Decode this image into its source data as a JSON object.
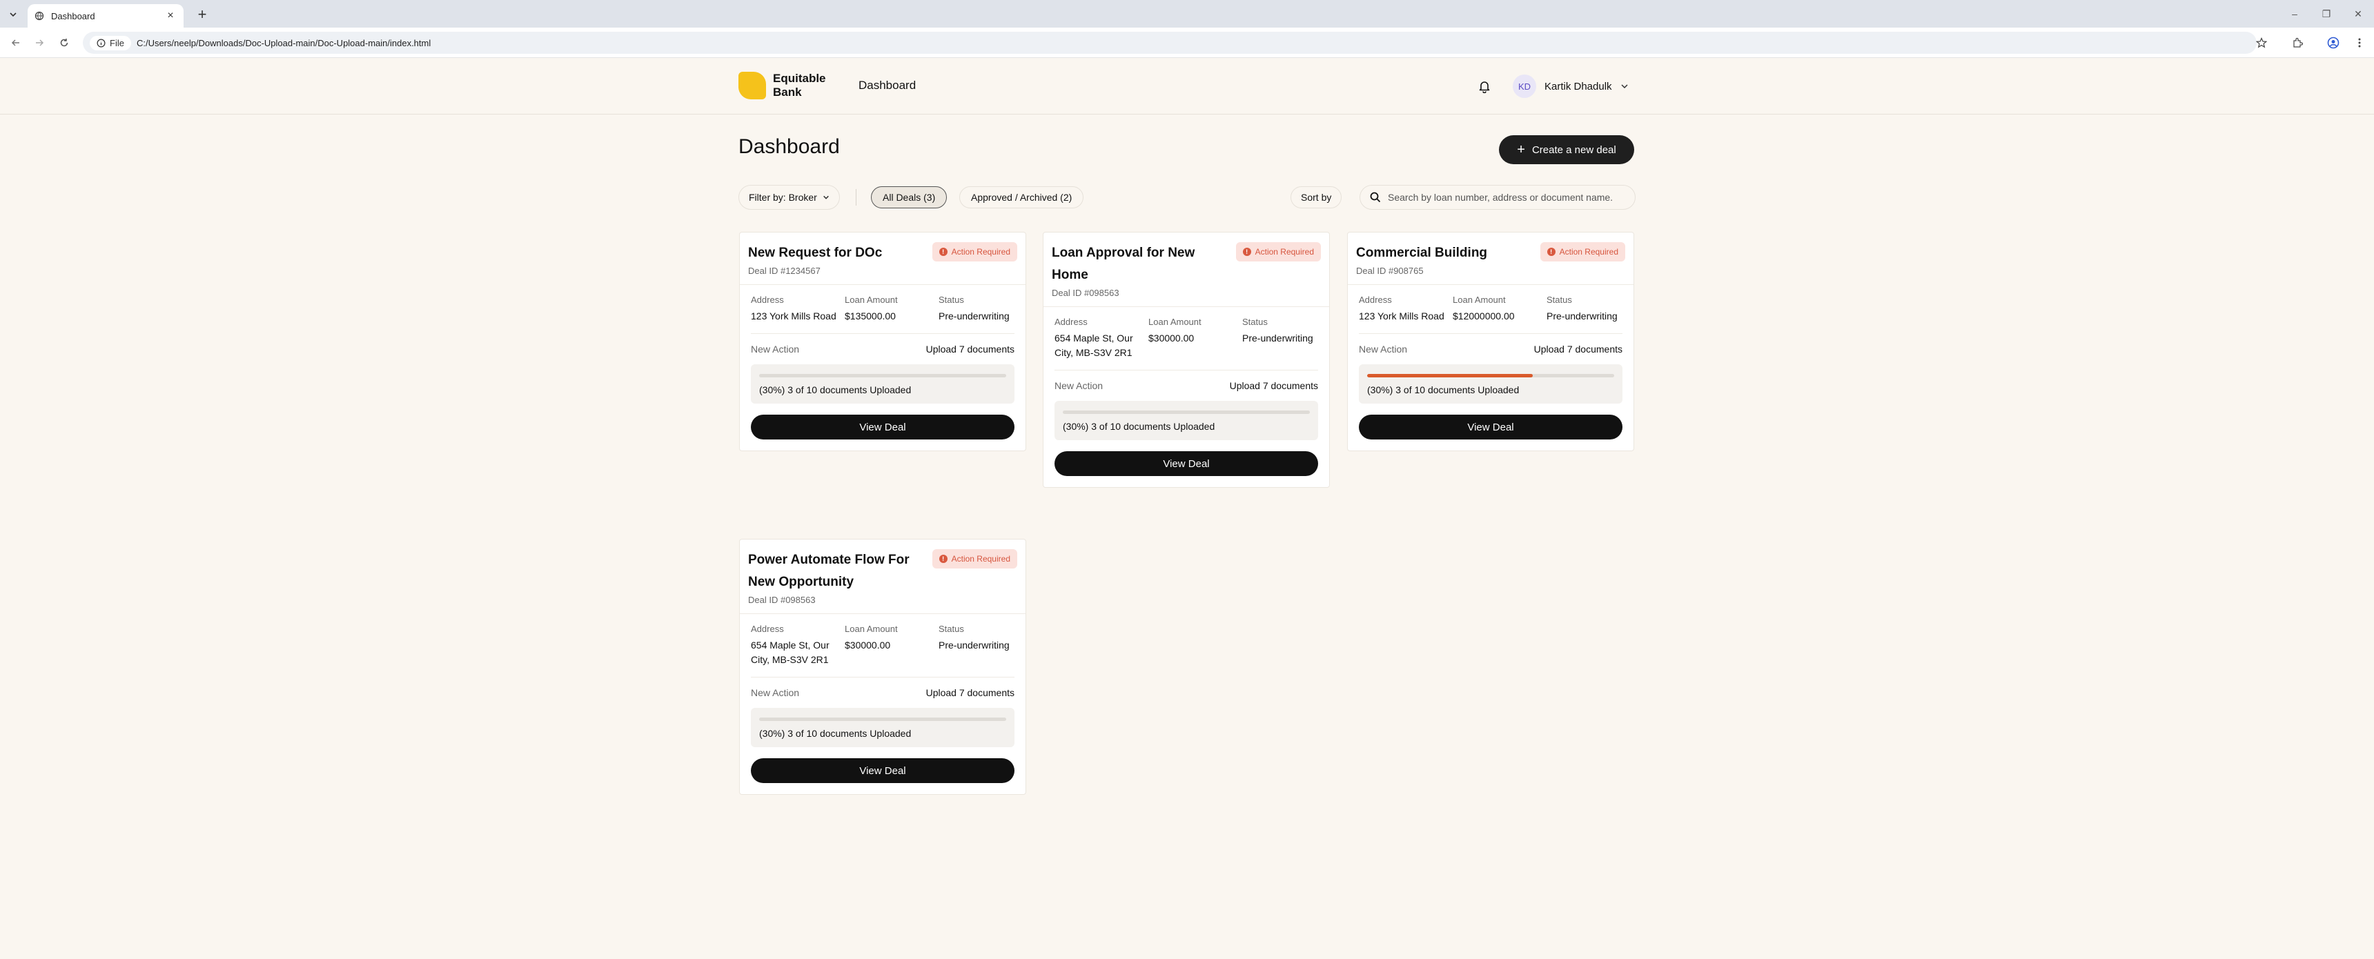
{
  "browser": {
    "tab_title": "Dashboard",
    "site_chip": "File",
    "url": "C:/Users/neelp/Downloads/Doc-Upload-main/Doc-Upload-main/index.html"
  },
  "header": {
    "logo_text": "Equitable Bank",
    "title": "Dashboard",
    "user": {
      "initials": "KD",
      "name": "Kartik Dhadulk"
    }
  },
  "page": {
    "title": "Dashboard",
    "create_label": "Create a new deal"
  },
  "filters": {
    "filter_label": "Filter by: Broker",
    "tabs": [
      {
        "label": "All Deals (3)",
        "active": true
      },
      {
        "label": "Approved / Archived (2)",
        "active": false
      }
    ],
    "sort_label": "Sort by",
    "search_placeholder": "Search by loan number, address or document name."
  },
  "labels": {
    "address": "Address",
    "loan_amount": "Loan Amount",
    "status": "Status",
    "new_action": "New Action",
    "view_deal": "View Deal"
  },
  "deals": [
    {
      "title": "New Request for DOc",
      "deal_id": "Deal ID #1234567",
      "badge": "Action Required",
      "address": "123 York Mills Road",
      "loan_amount": "$135000.00",
      "status": "Pre-underwriting",
      "new_action": "Upload 7 documents",
      "progress": 0,
      "progress_text": "(30%) 3 of 10 documents Uploaded"
    },
    {
      "title": "Loan Approval for New Home",
      "deal_id": "Deal ID #098563",
      "badge": "Action Required",
      "address": "654 Maple St, Our City, MB-S3V 2R1",
      "loan_amount": "$30000.00",
      "status": "Pre-underwriting",
      "new_action": "Upload 7 documents",
      "progress": 0,
      "progress_text": "(30%) 3 of 10 documents Uploaded"
    },
    {
      "title": "Commercial Building",
      "deal_id": "Deal ID #908765",
      "badge": "Action Required",
      "address": "123 York Mills Road",
      "loan_amount": "$12000000.00",
      "status": "Pre-underwriting",
      "new_action": "Upload 7 documents",
      "progress": 0.67,
      "progress_text": "(30%) 3 of 10 documents Uploaded"
    },
    {
      "title": "Power Automate Flow For New Opportunity",
      "deal_id": "Deal ID #098563",
      "badge": "Action Required",
      "address": "654 Maple St, Our City, MB-S3V 2R1",
      "loan_amount": "$30000.00",
      "status": "Pre-underwriting",
      "new_action": "Upload 7 documents",
      "progress": 0,
      "progress_text": "(30%) 3 of 10 documents Uploaded"
    }
  ],
  "colors": {
    "accent_progress": "#d95a2b",
    "badge_text": "#d6553e",
    "badge_bg": "#fbe1dc",
    "logo": "#f5c21b",
    "primary_button": "#1f1f1f"
  }
}
